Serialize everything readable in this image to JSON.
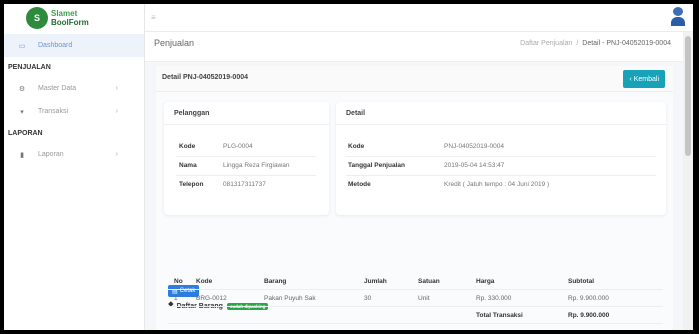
{
  "logo": {
    "line1": "Slamet",
    "line2": "BoolForm"
  },
  "sidebar": {
    "items": [
      {
        "label": "Dashboard",
        "icon": "monitor-icon",
        "active": true
      },
      {
        "section": "PENJUALAN"
      },
      {
        "label": "Master Data",
        "icon": "cogs-icon"
      },
      {
        "label": "Transaksi",
        "icon": "cart-icon"
      },
      {
        "section": "LAPORAN"
      },
      {
        "label": "Laporan",
        "icon": "file-icon"
      }
    ]
  },
  "header": {
    "title": "Penjualan",
    "breadcrumb": [
      "Daftar Penjualan",
      "Detail - PNJ-04052019-0004"
    ]
  },
  "card": {
    "title": "Detail PNJ-04052019-0004",
    "back_label": "Kembali"
  },
  "pelanggan": {
    "title": "Pelanggan",
    "rows": [
      {
        "k": "Kode",
        "v": "PLG-0004"
      },
      {
        "k": "Nama",
        "v": "Lingga Reza Firgiawan"
      },
      {
        "k": "Telepon",
        "v": "081317311737"
      }
    ]
  },
  "detail": {
    "title": "Detail",
    "rows": [
      {
        "k": "Kode",
        "v": "PNJ-04052019-0004"
      },
      {
        "k": "Tanggal Penjualan",
        "v": "2019-05-04 14:53:47"
      },
      {
        "k": "Metode",
        "v": "Kredit ( Jatuh tempo : 04 Juni 2019 )"
      }
    ]
  },
  "actions": {
    "cetak_label": "Cetak"
  },
  "daftar": {
    "title": "Daftar Barang",
    "badge": "sudah dipacking"
  },
  "table": {
    "headers": [
      "No",
      "Kode",
      "Barang",
      "Jumlah",
      "Satuan",
      "Harga",
      "Subtotal"
    ],
    "rows": [
      [
        "1",
        "BRG-0012",
        "Pakan Puyuh Sak",
        "30",
        "Unit",
        "Rp. 330.000",
        "Rp. 9.900.000"
      ]
    ],
    "total_label": "Total Transaksi",
    "total_value": "Rp. 9.900.000"
  },
  "colors": {
    "accent": "#17a2b8",
    "primary": "#2d7de0",
    "success": "#28a745"
  }
}
